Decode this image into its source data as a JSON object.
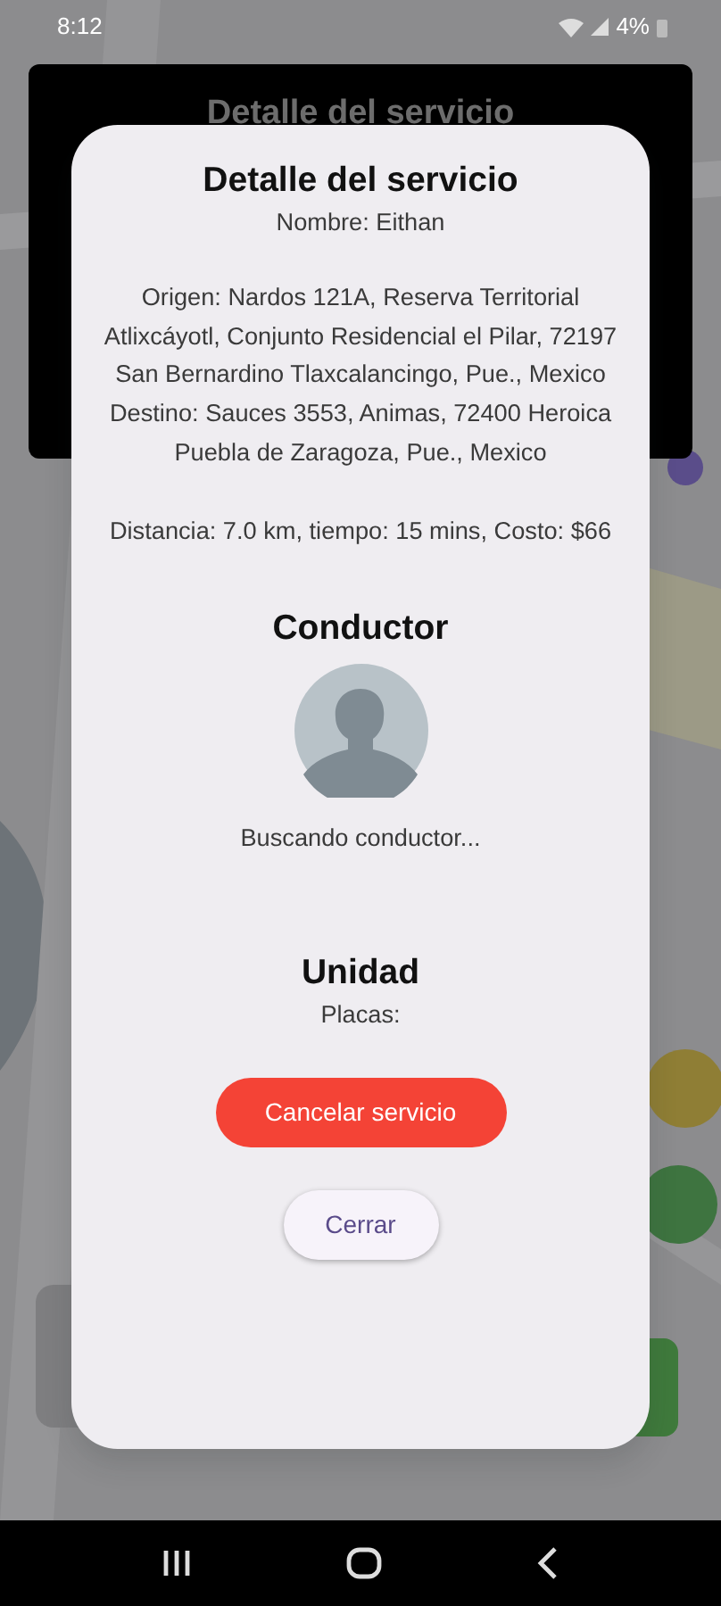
{
  "status_bar": {
    "time": "8:12",
    "battery": "4%"
  },
  "background_dialog": {
    "title": "Detalle del servicio"
  },
  "dialog": {
    "title": "Detalle del servicio",
    "name": "Nombre: Eithan",
    "origin": "Origen: Nardos 121A, Reserva Territorial Atlixcáyotl, Conjunto Residencial el Pilar, 72197 San Bernardino Tlaxcalancingo, Pue., Mexico",
    "destination": "Destino: Sauces 3553, Animas, 72400 Heroica Puebla de Zaragoza, Pue., Mexico",
    "trip": "Distancia: 7.0 km, tiempo: 15 mins, Costo: $66",
    "driver": {
      "heading": "Conductor",
      "status": "Buscando conductor..."
    },
    "unit": {
      "heading": "Unidad",
      "plates": "Placas:"
    },
    "buttons": [
      {
        "kind": "danger",
        "label": "Cancelar servicio"
      },
      {
        "kind": "plain",
        "label": "Cerrar"
      }
    ]
  }
}
